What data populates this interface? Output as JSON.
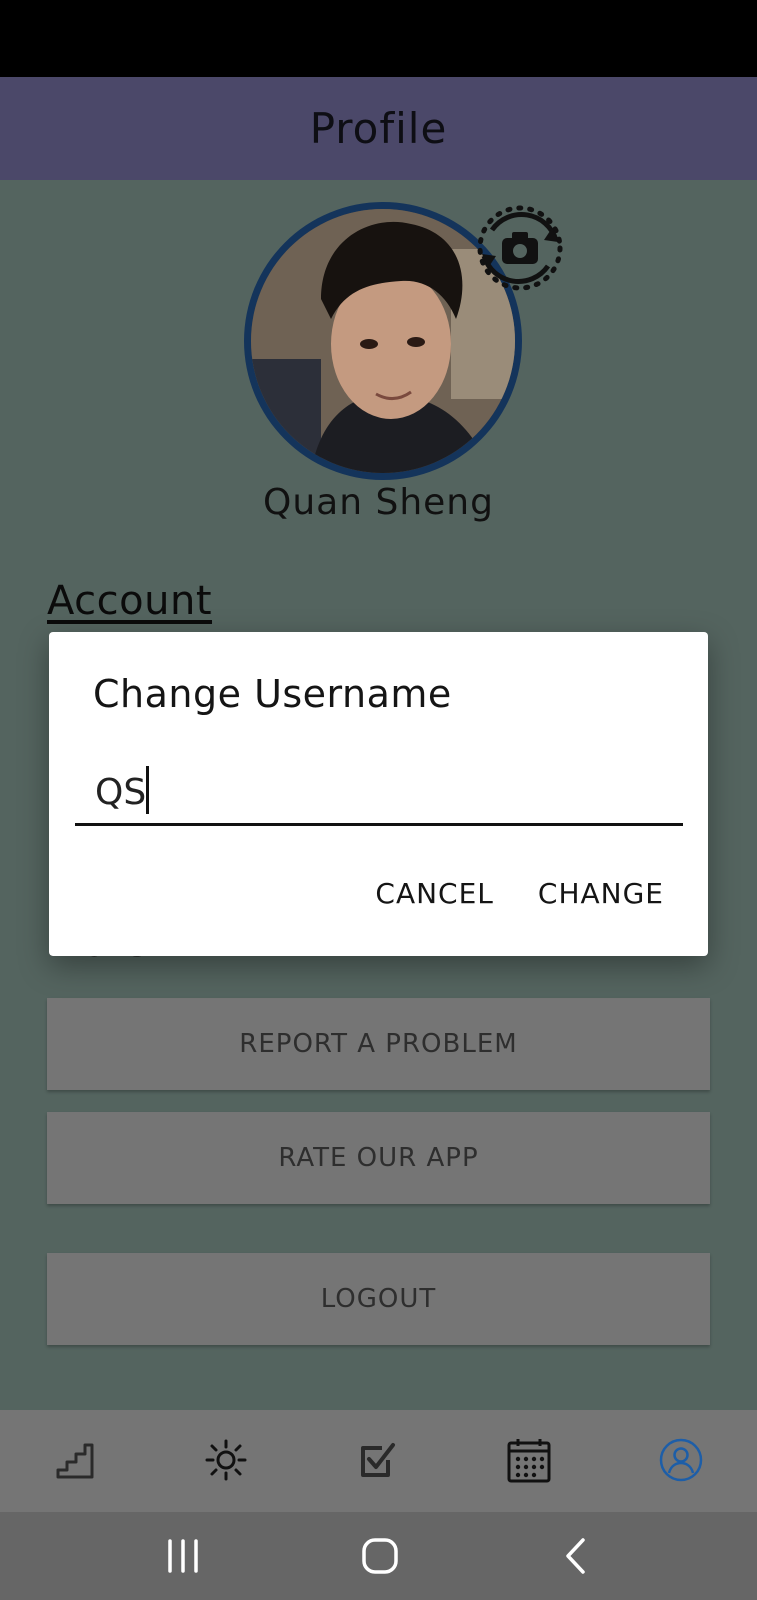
{
  "header": {
    "title": "Profile"
  },
  "profile": {
    "name": "Quan Sheng"
  },
  "sections": {
    "account": "Account",
    "more": "More"
  },
  "menu": {
    "report_label": "REPORT A PROBLEM",
    "rate_label": "RATE OUR APP",
    "logout_label": "LOGOUT"
  },
  "dialog": {
    "title": "Change Username",
    "input_value": "QS",
    "cancel_label": "CANCEL",
    "change_label": "CHANGE"
  },
  "bottom_nav": {
    "items": [
      {
        "icon": "stairs-icon"
      },
      {
        "icon": "sun-icon"
      },
      {
        "icon": "checkbox-icon"
      },
      {
        "icon": "calendar-icon"
      },
      {
        "icon": "profile-icon",
        "active": true
      }
    ],
    "active_color": "#1d5ea8"
  },
  "system_nav": {
    "icons": [
      "recent-apps-icon",
      "home-icon",
      "back-icon"
    ]
  }
}
